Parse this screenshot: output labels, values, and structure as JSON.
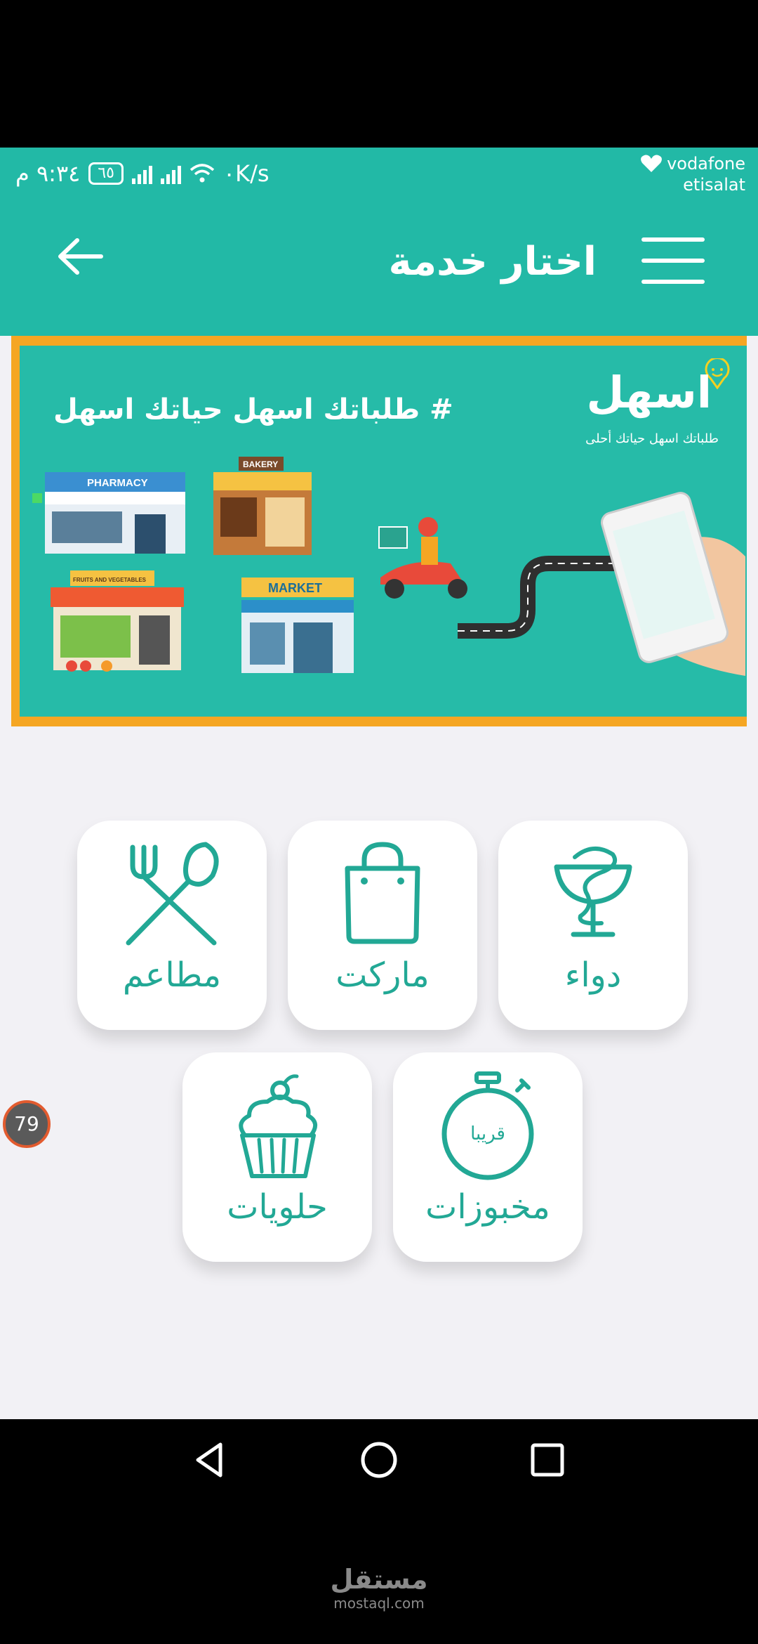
{
  "status": {
    "time": "٩:٣٤ م",
    "battery": "٦٥",
    "net1": "2G",
    "net2": "3G",
    "speed": "٠K/s",
    "carrier1": "vodafone",
    "carrier2": "etisalat"
  },
  "header": {
    "title": "اختار خدمة"
  },
  "banner": {
    "tagline": "# طلباتك اسهل حياتك اسهل",
    "logo": "اسهل",
    "logo_sub": "طلباتك اسهل حياتك أحلى",
    "shop_labels": [
      "PHARMACY",
      "BAKERY",
      "FRUITS AND VEGETABLES",
      "MARKET"
    ]
  },
  "services": [
    {
      "label": "دواء",
      "icon": "pharmacy-icon"
    },
    {
      "label": "ماركت",
      "icon": "shopping-bag-icon"
    },
    {
      "label": "مطاعم",
      "icon": "fork-spoon-icon"
    },
    {
      "label": "مخبوزات",
      "icon": "stopwatch-icon",
      "badge": "قريبا"
    },
    {
      "label": "حلويات",
      "icon": "cupcake-icon"
    }
  ],
  "chathead": {
    "count": "79"
  },
  "watermark": {
    "arabic": "مستقل",
    "latin": "mostaql.com"
  },
  "colors": {
    "primary": "#22b9a6",
    "accent": "#f5a623",
    "label": "#22a895"
  }
}
